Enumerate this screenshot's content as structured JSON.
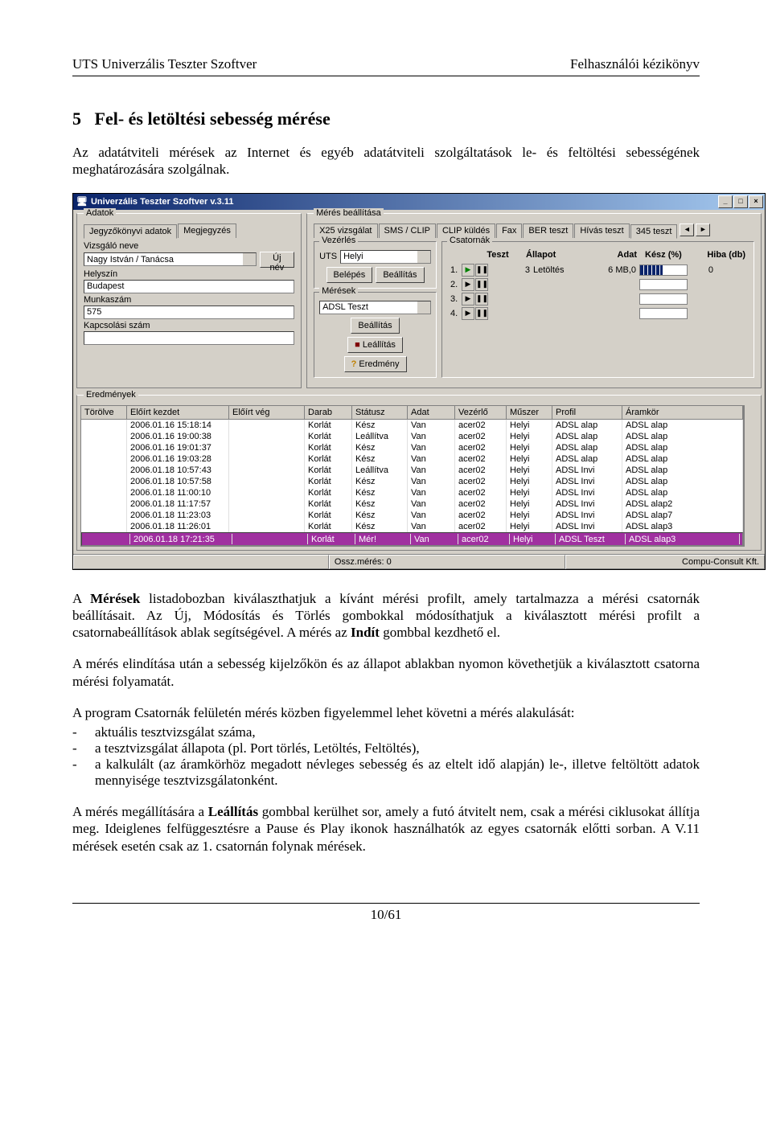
{
  "header": {
    "left": "UTS Univerzális Teszter Szoftver",
    "right": "Felhasználói kézikönyv"
  },
  "section_number": "5",
  "section_title": "Fel- és letöltési sebesség mérése",
  "para1": "Az adatátviteli mérések az Internet és egyéb adatátviteli szolgáltatások le- és feltöltési sebességének meghatározására szolgálnak.",
  "para2_a": "A ",
  "para2_b": "Mérések",
  "para2_c": " listadobozban kiválaszthatjuk a kívánt mérési profilt, amely tartalmazza a mérési csatornák beállításait. Az Új, Módosítás és Törlés gombokkal módosíthatjuk a kiválasztott mérési profilt a csatornabeállítások ablak segítségével. A mérés az ",
  "para2_d": "Indít",
  "para2_e": " gombbal kezdhető el.",
  "para3": "A mérés elindítása után a sebesség kijelzőkön és az állapot ablakban nyomon követhetjük a kiválasztott csatorna mérési folyamatát.",
  "para4": "A program Csatornák felületén mérés közben figyelemmel lehet követni a mérés alakulását:",
  "li1": "aktuális tesztvizsgálat száma,",
  "li2": "a tesztvizsgálat állapota (pl. Port törlés, Letöltés, Feltöltés),",
  "li3": "a kalkulált (az áramkörhöz megadott névleges sebesség és az eltelt idő alapján) le-, illetve feltöltött adatok mennyisége tesztvizsgálatonként.",
  "para5_a": "A mérés megállítására a ",
  "para5_b": "Leállítás",
  "para5_c": " gombbal kerülhet sor, amely a futó átvitelt nem, csak a mérési ciklusokat állítja meg. Ideiglenes felfüggesztésre a Pause és Play ikonok használhatók az egyes csatornák előtti sorban. A V.11 mérések esetén csak az 1. csatornán folynak mérések.",
  "pagefoot": "10/61",
  "app": {
    "title": "Univerzális Teszter Szoftver v.3.11",
    "panels": {
      "adatok": "Adatok",
      "meres": "Mérés beállítása",
      "eredmenyek": "Eredmények"
    },
    "tabs_adatok": [
      "Jegyzőkönyvi adatok",
      "Megjegyzés"
    ],
    "adatok": {
      "vizsgalo_lbl": "Vizsgáló neve",
      "vizsgalo_val": "Nagy István / Tanácsa",
      "ujnev": "Új név",
      "helyszin_lbl": "Helyszín",
      "helyszin_val": "Budapest",
      "munkaszam_lbl": "Munkaszám",
      "munkaszam_val": "575",
      "kapcs_lbl": "Kapcsolási szám",
      "kapcs_val": ""
    },
    "tabs_meres": [
      "X25 vizsgálat",
      "SMS / CLIP",
      "CLIP küldés",
      "Fax",
      "BER teszt",
      "Hívás teszt",
      "345 teszt"
    ],
    "vezerles": {
      "title": "Vezérlés",
      "uts_lbl": "UTS",
      "uts_val": "Helyi",
      "belepes": "Belépés",
      "beallitas": "Beállítás"
    },
    "meresek": {
      "title": "Mérések",
      "sel": "ADSL Teszt",
      "beallitas": "Beállítás",
      "leallitas": "Leállítás",
      "eredmeny": "Eredmény"
    },
    "csatornak": {
      "title": "Csatornák",
      "head": [
        "Teszt",
        "Állapot",
        "Adat",
        "Kész (%)",
        "Hiba (db)"
      ]
    },
    "csat_rows": [
      {
        "n": "1.",
        "active": true,
        "teszt": "3",
        "allapot": "Letöltés",
        "adat": "6 MB,0",
        "kesz": 48,
        "hiba": "0"
      },
      {
        "n": "2.",
        "active": false
      },
      {
        "n": "3.",
        "active": false
      },
      {
        "n": "4.",
        "active": false
      }
    ],
    "grid": {
      "head": [
        "Törölve",
        "Előírt kezdet",
        "Előírt vég",
        "Darab",
        "Státusz",
        "Adat",
        "Vezérlő",
        "Műszer",
        "Profil",
        "Áramkör"
      ],
      "rows": [
        [
          "",
          "2006.01.16 15:18:14",
          "",
          "Korlát",
          "Kész",
          "Van",
          "acer02",
          "Helyi",
          "ADSL alap",
          "ADSL alap"
        ],
        [
          "",
          "2006.01.16 19:00:38",
          "",
          "Korlát",
          "Leállítva",
          "Van",
          "acer02",
          "Helyi",
          "ADSL alap",
          "ADSL alap"
        ],
        [
          "",
          "2006.01.16 19:01:37",
          "",
          "Korlát",
          "Kész",
          "Van",
          "acer02",
          "Helyi",
          "ADSL alap",
          "ADSL alap"
        ],
        [
          "",
          "2006.01.16 19:03:28",
          "",
          "Korlát",
          "Kész",
          "Van",
          "acer02",
          "Helyi",
          "ADSL alap",
          "ADSL alap"
        ],
        [
          "",
          "2006.01.18 10:57:43",
          "",
          "Korlát",
          "Leállítva",
          "Van",
          "acer02",
          "Helyi",
          "ADSL Invi",
          "ADSL alap"
        ],
        [
          "",
          "2006.01.18 10:57:58",
          "",
          "Korlát",
          "Kész",
          "Van",
          "acer02",
          "Helyi",
          "ADSL Invi",
          "ADSL alap"
        ],
        [
          "",
          "2006.01.18 11:00:10",
          "",
          "Korlát",
          "Kész",
          "Van",
          "acer02",
          "Helyi",
          "ADSL Invi",
          "ADSL alap"
        ],
        [
          "",
          "2006.01.18 11:17:57",
          "",
          "Korlát",
          "Kész",
          "Van",
          "acer02",
          "Helyi",
          "ADSL Invi",
          "ADSL alap2"
        ],
        [
          "",
          "2006.01.18 11:23:03",
          "",
          "Korlát",
          "Kész",
          "Van",
          "acer02",
          "Helyi",
          "ADSL Invi",
          "ADSL alap7"
        ],
        [
          "",
          "2006.01.18 11:26:01",
          "",
          "Korlát",
          "Kész",
          "Van",
          "acer02",
          "Helyi",
          "ADSL Invi",
          "ADSL alap3"
        ],
        [
          "",
          "2006.01.18 17:21:35",
          "",
          "Korlát",
          "Mér!",
          "Van",
          "acer02",
          "Helyi",
          "ADSL Teszt",
          "ADSL alap3"
        ]
      ],
      "selected": 10
    },
    "status": {
      "left": "",
      "mid": "Ossz.mérés: 0",
      "right": "Compu-Consult Kft."
    }
  }
}
